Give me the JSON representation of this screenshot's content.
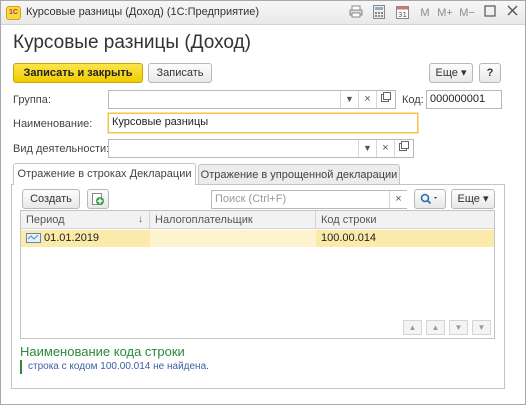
{
  "window": {
    "logo_text": "1С",
    "title": "Курсовые разницы (Доход)  (1С:Предприятие)",
    "icons": [
      "print-icon",
      "calculator-icon",
      "calendar-icon",
      "M",
      "M+",
      "M−",
      "restore-icon",
      "close-icon"
    ],
    "mem_labels": [
      "M",
      "M+",
      "M−"
    ]
  },
  "form": {
    "title": "Курсовые разницы (Доход)"
  },
  "toolbar": {
    "save_close_label": "Записать и закрыть",
    "save_label": "Записать",
    "more_label": "Еще ▾",
    "help_label": "?"
  },
  "fields": {
    "group_label": "Группа:",
    "group_value": "",
    "code_label": "Код:",
    "code_value": "000000001",
    "name_label": "Наименование:",
    "name_value": "Курсовые разницы",
    "activity_label": "Вид деятельности:",
    "activity_value": ""
  },
  "tabs": [
    {
      "label": "Отражение в строках Декларации",
      "active": true
    },
    {
      "label": "Отражение в упрощенной декларации",
      "active": false
    }
  ],
  "table_toolbar": {
    "create_label": "Создать",
    "search_placeholder": "Поиск (Ctrl+F)",
    "more_label": "Еще ▾"
  },
  "table": {
    "columns": [
      "Период",
      "Налогоплательщик",
      "Код строки"
    ],
    "sort_indicator": "↓",
    "rows": [
      {
        "period": "01.01.2019",
        "taxpayer": "",
        "line_code": "100.00.014"
      }
    ]
  },
  "details": {
    "title": "Наименование кода строки",
    "note": "строка с кодом 100.00.014 не найдена."
  },
  "colors": {
    "accent_yellow": "#f2cc00",
    "selection": "#fbeaa9",
    "section_green": "#2a8a3a",
    "note_blue": "#3c5fa5"
  }
}
